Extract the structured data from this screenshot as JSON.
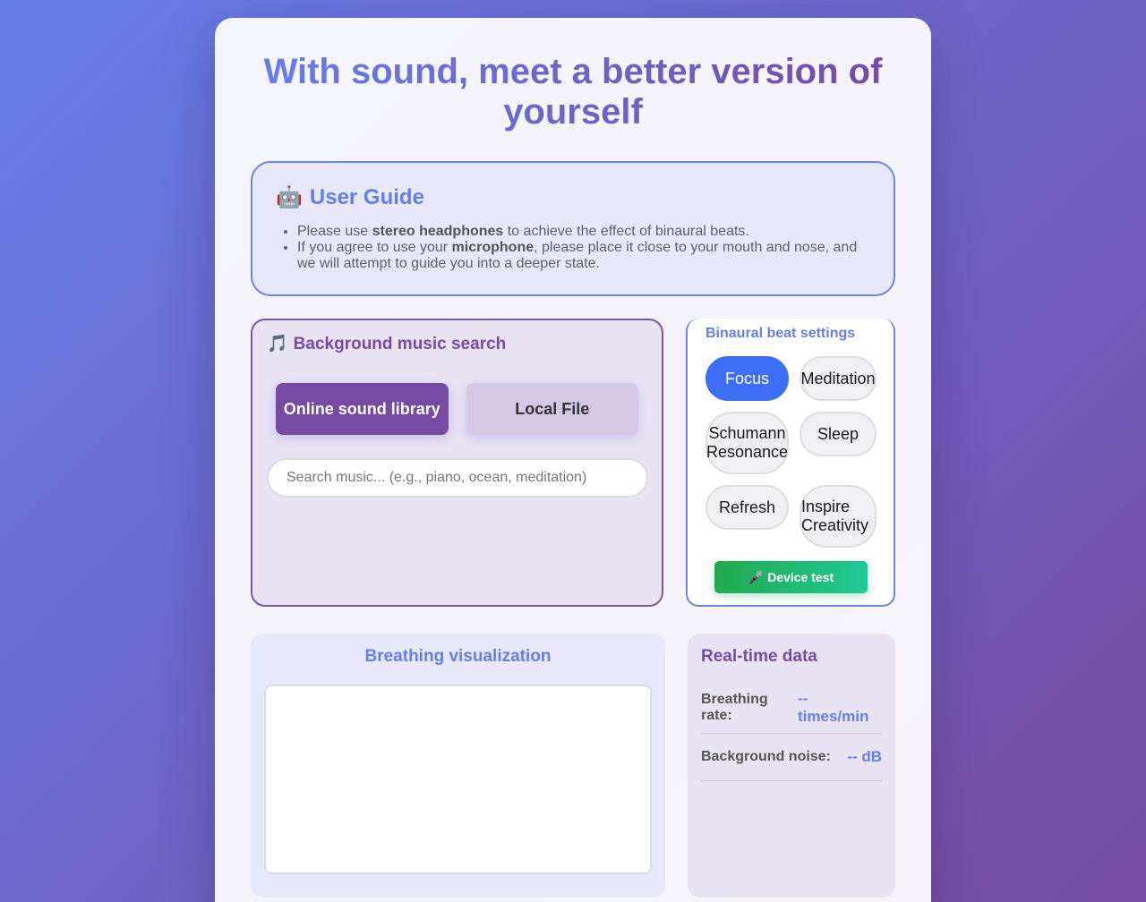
{
  "page": {
    "title": "With sound, meet a better version of yourself"
  },
  "guide": {
    "icon": "robot-icon",
    "title": "User Guide",
    "item1": {
      "pre": "Please use ",
      "bold": "stereo headphones",
      "post": " to achieve the effect of binaural beats."
    },
    "item2": {
      "pre": "If you agree to use your ",
      "bold": "microphone",
      "post": ", please place it close to your mouth and nose, and we will attempt to guide you into a deeper state."
    }
  },
  "music": {
    "icon": "music-note-icon",
    "title": "Background music search",
    "online_label": "Online sound library",
    "local_label": "Local File",
    "search_placeholder": "Search music... (e.g., piano, ocean, meditation)",
    "active_source": "Online sound library"
  },
  "beats": {
    "title": "Binaural beat settings",
    "presets": [
      "Focus",
      "Meditation",
      "Schumann Resonance",
      "Sleep",
      "Refresh",
      "Inspire Creativity"
    ],
    "active_preset": "Focus",
    "device_test_icon": "microphone-icon",
    "device_test_label": "Device test"
  },
  "breathing": {
    "title": "Breathing visualization"
  },
  "realtime": {
    "title": "Real-time data",
    "rate_label": "Breathing rate:",
    "rate_value": "-- times/min",
    "noise_label": "Background noise:",
    "noise_value": "-- dB"
  },
  "colors": {
    "accent_blue": "#667eea",
    "accent_purple": "#764ba2",
    "preset_active": "#3d6ef5",
    "device_green": "#23a84f"
  }
}
